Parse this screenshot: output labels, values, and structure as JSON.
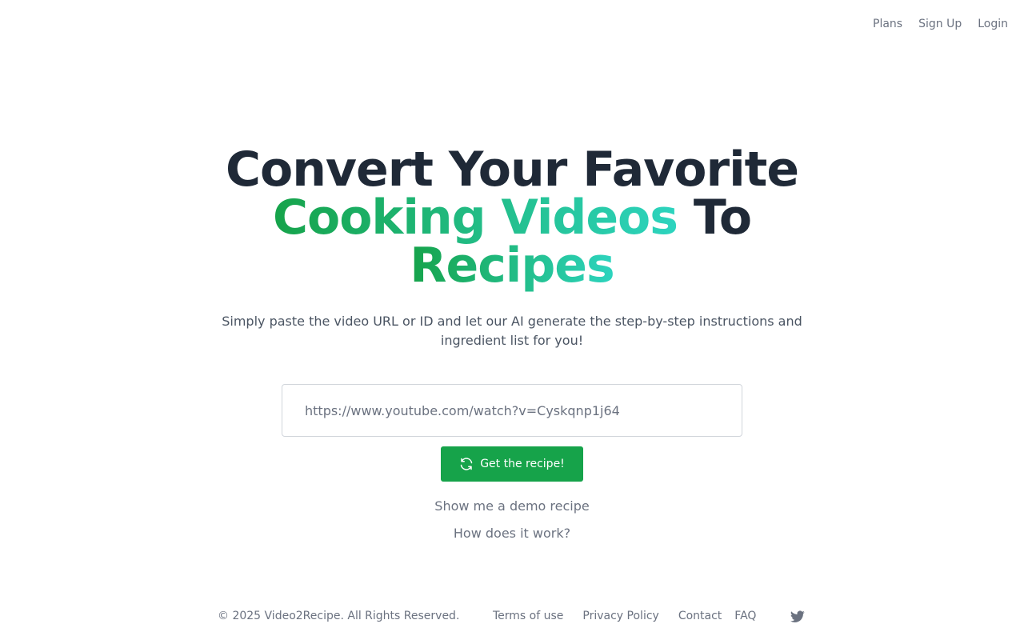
{
  "nav": {
    "items": [
      "Plans",
      "Sign Up",
      "Login"
    ]
  },
  "hero": {
    "headline_line1": "Convert Your Favorite",
    "headline_line2_highlight": "Cooking Videos",
    "headline_line2_tail": "To",
    "headline_line3_highlight": "Recipes",
    "subtitle": "Simply paste the video URL or ID and let our AI generate the step-by-step instructions and ingredient list for you!"
  },
  "form": {
    "url_placeholder": "https://www.youtube.com/watch?v=Cyskqnp1j64",
    "url_value": "",
    "submit_label": "Get the recipe!",
    "submit_icon": "refresh-icon"
  },
  "links": {
    "demo": "Show me a demo recipe",
    "how": "How does it work?"
  },
  "footer": {
    "copyright": "© 2025 Video2Recipe. All Rights Reserved.",
    "links": [
      "Terms of use",
      "Privacy Policy",
      "Contact",
      "FAQ"
    ],
    "social_icon": "twitter-icon"
  },
  "colors": {
    "brand_green": "#16a34a",
    "gradient_end": "#2dd4bf",
    "headline": "#1f2937",
    "muted": "#6b7280"
  }
}
